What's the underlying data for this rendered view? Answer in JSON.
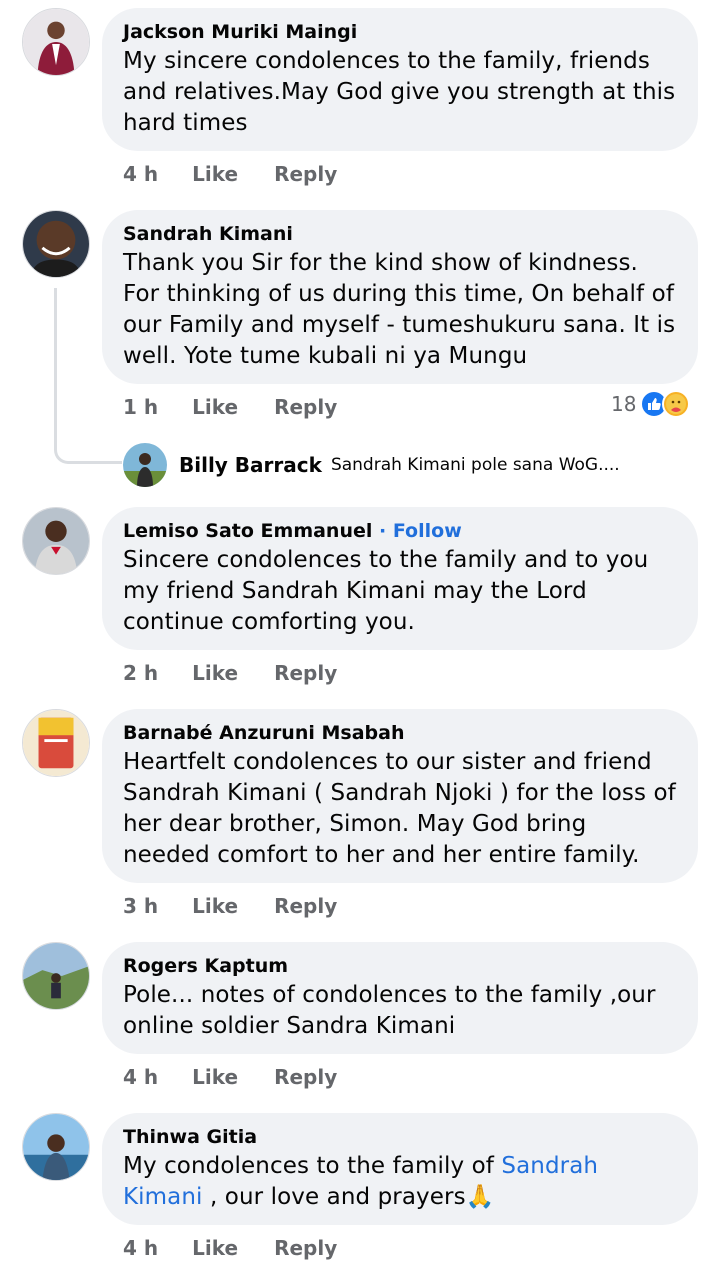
{
  "comments": [
    {
      "author": "Jackson Muriki Maingi",
      "text": "My sincere condolences to the family, friends and relatives.May God give you strength at this hard times",
      "time": "4 h",
      "like": "Like",
      "reply": "Reply"
    },
    {
      "author": "Sandrah Kimani",
      "text": "Thank you Sir for the kind show of kindness. For thinking of us during this time, On behalf of our Family and myself - tumeshukuru sana. It is well. Yote tume kubali ni ya Mungu",
      "time": "1 h",
      "like": "Like",
      "reply": "Reply",
      "reaction_count": "18",
      "reply_preview": {
        "author": "Billy Barrack",
        "text": "Sandrah Kimani pole sana WoG...."
      }
    },
    {
      "author": "Lemiso Sato Emmanuel",
      "follow": "· Follow",
      "text": "Sincere condolences to the family and to you my friend Sandrah Kimani may the Lord continue comforting you.",
      "time": "2 h",
      "like": "Like",
      "reply": "Reply"
    },
    {
      "author": "Barnabé Anzuruni Msabah",
      "text": "Heartfelt condolences to our sister and friend Sandrah Kimani ( Sandrah Njoki ) for the loss of her dear brother, Simon. May God bring needed comfort to her and her entire family.",
      "time": "3 h",
      "like": "Like",
      "reply": "Reply"
    },
    {
      "author": "Rogers Kaptum",
      "text": "Pole... notes of condolences to the family ,our online soldier Sandra Kimani",
      "time": "4 h",
      "like": "Like",
      "reply": "Reply"
    },
    {
      "author": "Thinwa Gitia",
      "text_before": "My condolences to the family of ",
      "mention": "Sandrah Kimani",
      "text_after": " , our love and prayers🙏",
      "time": "4 h",
      "like": "Like",
      "reply": "Reply"
    }
  ],
  "icons": {
    "like_reaction": "thumbs-up-icon",
    "care_reaction": "care-emoji-icon"
  },
  "colors": {
    "bubble": "#f0f2f5",
    "link": "#216fdb",
    "secondary_text": "#65676b"
  }
}
